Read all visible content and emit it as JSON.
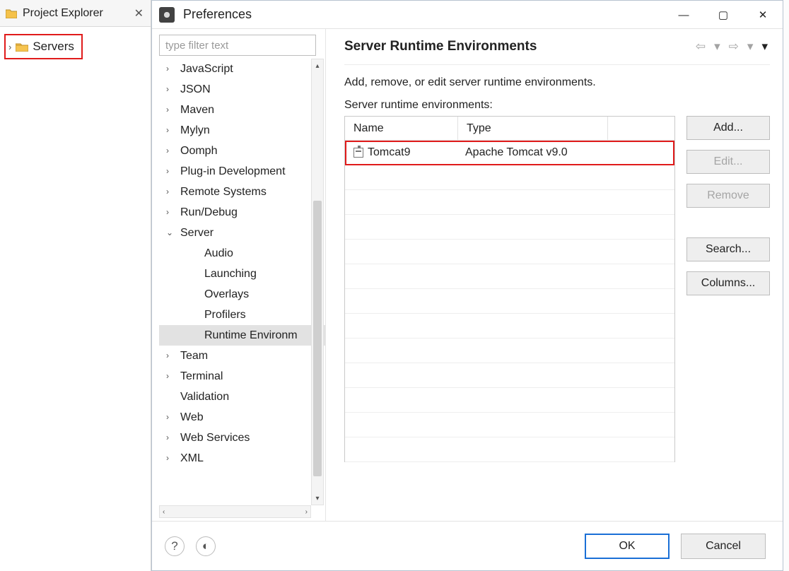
{
  "explorer": {
    "title": "Project Explorer",
    "servers_label": "Servers"
  },
  "dialog": {
    "title": "Preferences",
    "filter_placeholder": "type filter text",
    "tree": [
      {
        "label": "JavaScript",
        "level": 1,
        "expandable": true,
        "chev": ">"
      },
      {
        "label": "JSON",
        "level": 1,
        "expandable": true,
        "chev": ">"
      },
      {
        "label": "Maven",
        "level": 1,
        "expandable": true,
        "chev": ">"
      },
      {
        "label": "Mylyn",
        "level": 1,
        "expandable": true,
        "chev": ">"
      },
      {
        "label": "Oomph",
        "level": 1,
        "expandable": true,
        "chev": ">"
      },
      {
        "label": "Plug-in Development",
        "level": 1,
        "expandable": true,
        "chev": ">"
      },
      {
        "label": "Remote Systems",
        "level": 1,
        "expandable": true,
        "chev": ">"
      },
      {
        "label": "Run/Debug",
        "level": 1,
        "expandable": true,
        "chev": ">"
      },
      {
        "label": "Server",
        "level": 1,
        "expandable": true,
        "chev": "v"
      },
      {
        "label": "Audio",
        "level": 2,
        "expandable": false,
        "chev": ""
      },
      {
        "label": "Launching",
        "level": 2,
        "expandable": false,
        "chev": ""
      },
      {
        "label": "Overlays",
        "level": 2,
        "expandable": false,
        "chev": ""
      },
      {
        "label": "Profilers",
        "level": 2,
        "expandable": false,
        "chev": ""
      },
      {
        "label": "Runtime Environm",
        "level": 2,
        "expandable": false,
        "chev": "",
        "selected": true
      },
      {
        "label": "Team",
        "level": 1,
        "expandable": true,
        "chev": ">"
      },
      {
        "label": "Terminal",
        "level": 1,
        "expandable": true,
        "chev": ">"
      },
      {
        "label": "Validation",
        "level": 1,
        "expandable": false,
        "chev": ""
      },
      {
        "label": "Web",
        "level": 1,
        "expandable": true,
        "chev": ">"
      },
      {
        "label": "Web Services",
        "level": 1,
        "expandable": true,
        "chev": ">"
      },
      {
        "label": "XML",
        "level": 1,
        "expandable": true,
        "chev": ">"
      }
    ],
    "content": {
      "heading": "Server Runtime Environments",
      "description": "Add, remove, or edit server runtime environments.",
      "table_label": "Server runtime environments:",
      "columns": {
        "name": "Name",
        "type": "Type"
      },
      "rows": [
        {
          "name": "Tomcat9",
          "type": "Apache Tomcat v9.0",
          "highlight": true
        }
      ],
      "buttons": {
        "add": "Add...",
        "edit": "Edit...",
        "remove": "Remove",
        "search": "Search...",
        "columns": "Columns..."
      }
    },
    "footer": {
      "ok": "OK",
      "cancel": "Cancel"
    }
  }
}
